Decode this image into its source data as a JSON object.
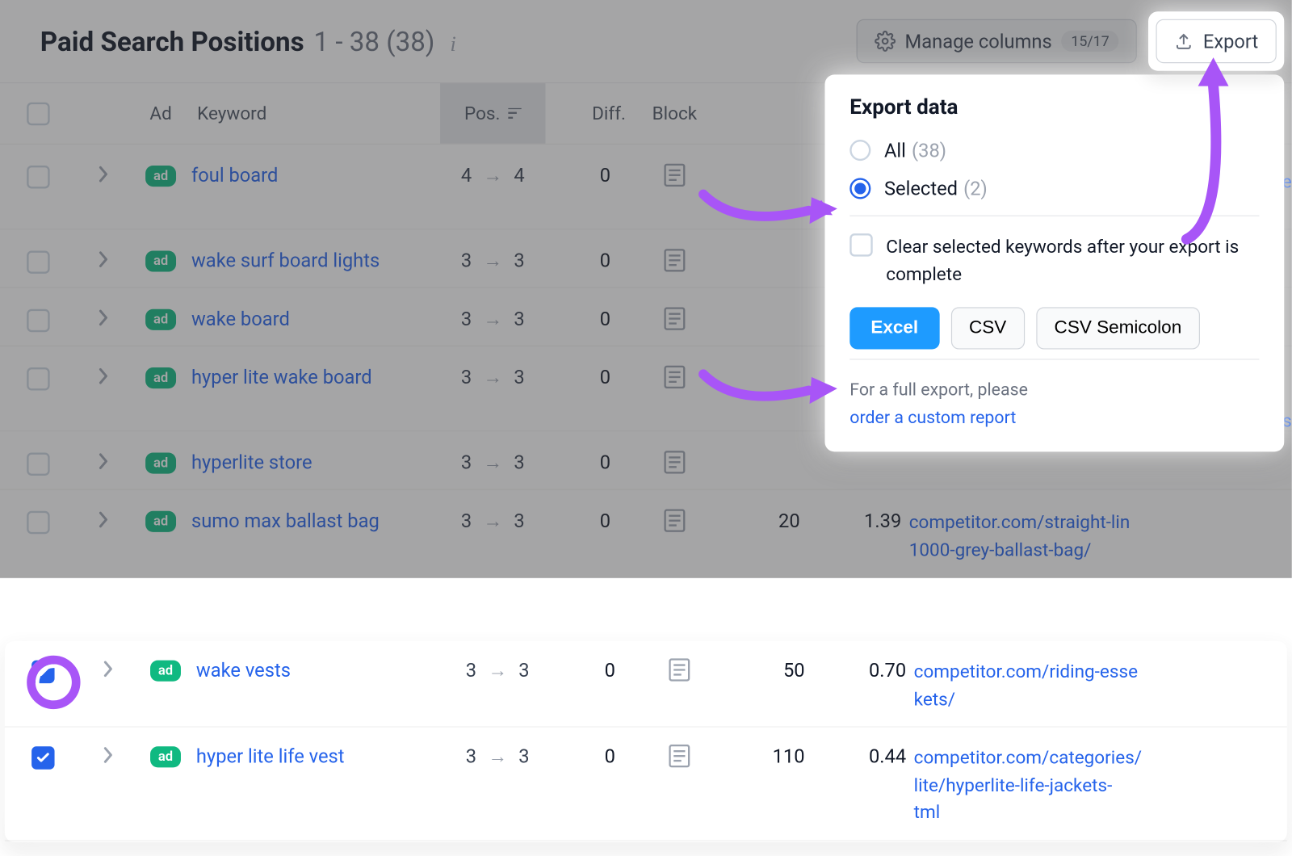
{
  "header": {
    "title": "Paid Search Positions",
    "range": "1 - 38 (38)"
  },
  "buttons": {
    "manage_columns": "Manage columns",
    "columns_count": "15/17",
    "export": "Export"
  },
  "columns": {
    "ad": "Ad",
    "keyword": "Keyword",
    "pos": "Pos.",
    "diff": "Diff.",
    "block": "Block"
  },
  "rows": [
    {
      "keyword": "foul board",
      "pos_from": "4",
      "pos_to": "4",
      "diff": "0",
      "selected": false
    },
    {
      "keyword": "wake surf board lights",
      "pos_from": "3",
      "pos_to": "3",
      "diff": "0",
      "selected": false
    },
    {
      "keyword": "wake board",
      "pos_from": "3",
      "pos_to": "3",
      "diff": "0",
      "selected": false
    },
    {
      "keyword": "hyper lite wake board",
      "pos_from": "3",
      "pos_to": "3",
      "diff": "0",
      "selected": false
    },
    {
      "keyword": "hyperlite store",
      "pos_from": "3",
      "pos_to": "3",
      "diff": "0",
      "selected": false
    },
    {
      "keyword": "sumo max ballast bag",
      "pos_from": "3",
      "pos_to": "3",
      "diff": "0",
      "selected": false,
      "vol": "20",
      "cpc": "1.39",
      "url": "competitor.com/straight-lin 1000-grey-ballast-bag/"
    }
  ],
  "selected_rows": [
    {
      "keyword": "wake vests",
      "pos_from": "3",
      "pos_to": "3",
      "diff": "0",
      "vol": "50",
      "cpc": "0.70",
      "url": "competitor.com/riding-esse kets/"
    },
    {
      "keyword": "hyper lite life vest",
      "pos_from": "3",
      "pos_to": "3",
      "diff": "0",
      "vol": "110",
      "cpc": "0.44",
      "url": "competitor.com/categories/ lite/hyperlite-life-jackets- tml"
    }
  ],
  "popup": {
    "title": "Export data",
    "all_label": "All",
    "all_count": "(38)",
    "selected_label": "Selected",
    "selected_count": "(2)",
    "clear_label": "Clear selected keywords after your export is complete",
    "excel": "Excel",
    "csv": "CSV",
    "csv_semi": "CSV Semicolon",
    "footer_text": "For a full export, please",
    "footer_link": "order a custom report"
  },
  "peek": {
    "a": "se",
    "b": "-s"
  },
  "ad_label": "ad"
}
